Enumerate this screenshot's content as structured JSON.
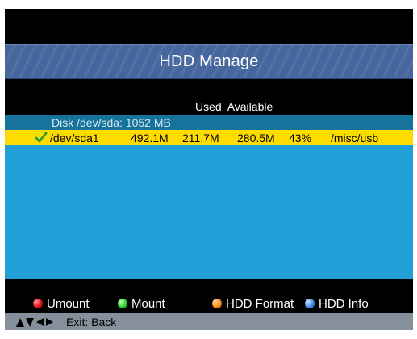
{
  "header": {
    "title": "HDD Manage"
  },
  "columns": {
    "used": "Used",
    "available": "Available"
  },
  "disk": {
    "label": "Disk /dev/sda: 1052 MB"
  },
  "partitions": [
    {
      "device": "/dev/sda1",
      "size": "492.1M",
      "used": "211.7M",
      "available": "280.5M",
      "percent": "43%",
      "mount": "/misc/usb",
      "selected": true
    }
  ],
  "footer": {
    "umount": "Umount",
    "mount": "Mount",
    "hdd_format": "HDD Format",
    "hdd_info": "HDD Info"
  },
  "nav": {
    "exit_hint": "Exit: Back"
  },
  "colors": {
    "title_bar": "#45669e",
    "panel": "#229fd6",
    "disk_row": "#16739c",
    "selected_row": "#ffdc00",
    "nav_bar": "#86909c",
    "umount_key": "#e01010",
    "mount_key": "#2fcf2f",
    "hdd_format_key": "#ff8a1a",
    "hdd_info_key": "#3f8ee8"
  },
  "icons": {
    "check": "check-icon",
    "red_key": "red-dot-icon",
    "green_key": "green-dot-icon",
    "orange_key": "orange-dot-icon",
    "blue_key": "blue-dot-icon",
    "nav": "navigation-arrows-icon"
  }
}
